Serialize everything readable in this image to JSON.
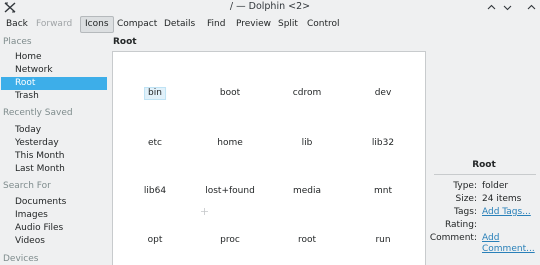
{
  "window": {
    "title": "/ — Dolphin <2>"
  },
  "toolbar": {
    "back": "Back",
    "forward": "Forward",
    "icons": "Icons",
    "compact": "Compact",
    "details": "Details",
    "find": "Find",
    "preview": "Preview",
    "split": "Split",
    "control": "Control"
  },
  "places": {
    "places_title": "Places",
    "places_items": [
      "Home",
      "Network",
      "Root",
      "Trash"
    ],
    "selected": "Root",
    "recently_saved_title": "Recently Saved",
    "recently_saved_items": [
      "Today",
      "Yesterday",
      "This Month",
      "Last Month"
    ],
    "search_for_title": "Search For",
    "search_for_items": [
      "Documents",
      "Images",
      "Audio Files",
      "Videos"
    ],
    "devices_title": "Devices"
  },
  "view": {
    "location": "Root",
    "mode": "Icons",
    "files": [
      "bin",
      "boot",
      "cdrom",
      "dev",
      "etc",
      "home",
      "lib",
      "lib32",
      "lib64",
      "lost+found",
      "media",
      "mnt",
      "opt",
      "proc",
      "root",
      "run"
    ],
    "hovered": "bin"
  },
  "info": {
    "title": "Root",
    "type_label": "Type:",
    "type_value": "folder",
    "size_label": "Size:",
    "size_value": "24 items",
    "tags_label": "Tags:",
    "tags_value": "Add Tags...",
    "rating_label": "Rating:",
    "rating_value": "",
    "comment_label": "Comment:",
    "comment_value_line1": "Add",
    "comment_value_line2": "Comment..."
  },
  "colors": {
    "accent": "#3daee9",
    "link": "#2980b9",
    "window_bg": "#eff0f1",
    "view_bg": "#ffffff"
  },
  "icons": {
    "app": "dolphin-app-icon",
    "shade": "shade-icon",
    "minimize": "minimize-icon",
    "maximize": "maximize-icon",
    "close": "close-icon"
  }
}
